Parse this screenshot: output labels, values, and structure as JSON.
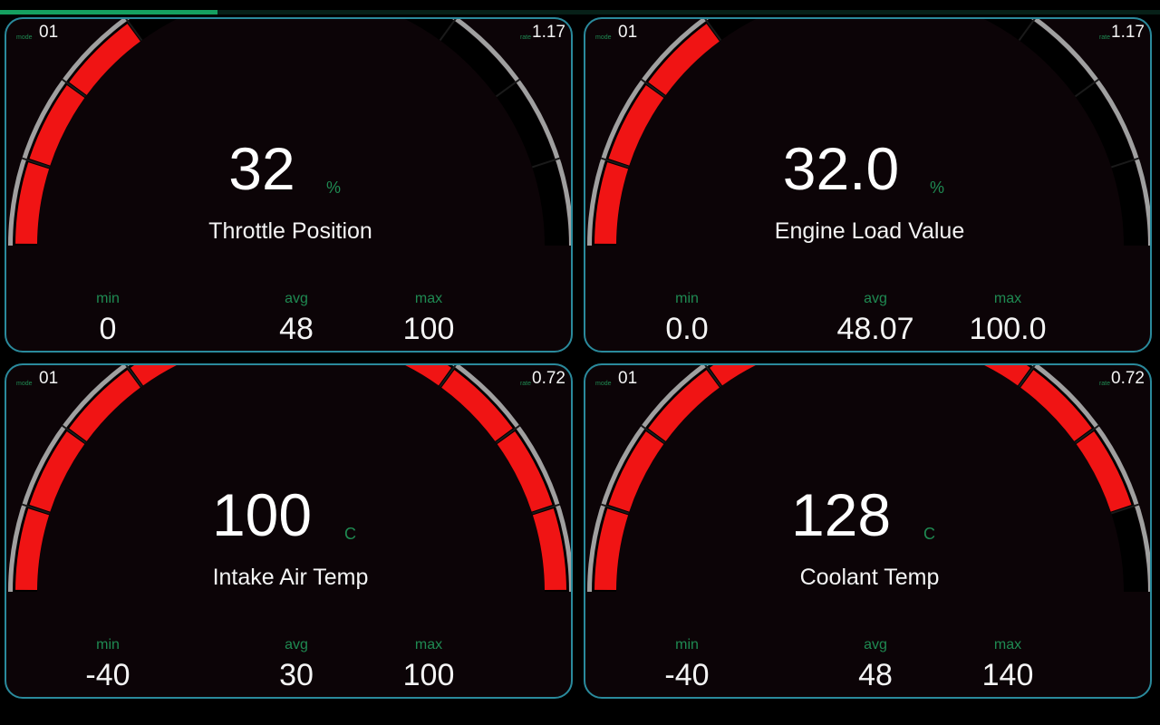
{
  "progress": {
    "fraction": 0.1875,
    "color": "#15a060"
  },
  "colors": {
    "panel_border": "#2a8a9c",
    "panel_bg": "#0c0407",
    "arc_active": "#f01414",
    "arc_inactive": "#000000",
    "rim": "#a0a0a0",
    "accent_text": "#1f8a52"
  },
  "gauges": [
    {
      "mode_label": "mode",
      "mode": "01",
      "rate_label": "rate",
      "rate": "1.17",
      "value": "32",
      "unit": "%",
      "title": "Throttle Position",
      "min_label": "min",
      "min": "0",
      "avg_label": "avg",
      "avg": "48",
      "max_label": "max",
      "max": "100",
      "level": 0.32
    },
    {
      "mode_label": "mode",
      "mode": "01",
      "rate_label": "rate",
      "rate": "1.17",
      "value": "32.0",
      "unit": "%",
      "title": "Engine Load Value",
      "min_label": "min",
      "min": "0.0",
      "avg_label": "avg",
      "avg": "48.07",
      "max_label": "max",
      "max": "100.0",
      "level": 0.32
    },
    {
      "mode_label": "mode",
      "mode": "01",
      "rate_label": "rate",
      "rate": "0.72",
      "value": "100",
      "unit": "C",
      "title": "Intake Air Temp",
      "min_label": "min",
      "min": "-40",
      "avg_label": "avg",
      "avg": "30",
      "max_label": "max",
      "max": "100",
      "level": 1.0
    },
    {
      "mode_label": "mode",
      "mode": "01",
      "rate_label": "rate",
      "rate": "0.72",
      "value": "128",
      "unit": "C",
      "title": "Coolant Temp",
      "min_label": "min",
      "min": "-40",
      "avg_label": "avg",
      "avg": "48",
      "max_label": "max",
      "max": "140",
      "level": 0.9
    }
  ]
}
